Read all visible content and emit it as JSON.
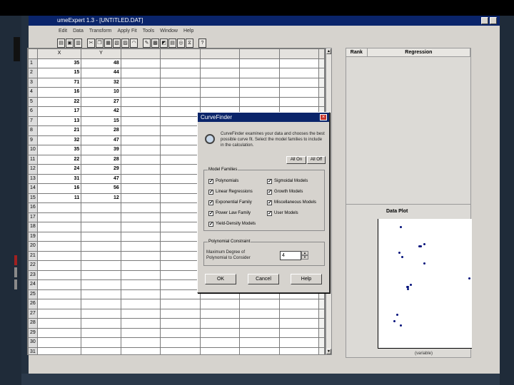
{
  "window": {
    "title": "umeExpert 1.3 - [UNTITLED.DAT]"
  },
  "menu": [
    "Edit",
    "Data",
    "Transform",
    "Apply Fit",
    "Tools",
    "Window",
    "Help"
  ],
  "sheet": {
    "columns": [
      "",
      "X",
      "Y",
      "",
      "",
      "",
      "",
      "",
      ""
    ],
    "rows": [
      {
        "n": "1",
        "x": "35",
        "y": "48"
      },
      {
        "n": "2",
        "x": "15",
        "y": "44"
      },
      {
        "n": "3",
        "x": "71",
        "y": "32"
      },
      {
        "n": "4",
        "x": "16",
        "y": "10"
      },
      {
        "n": "5",
        "x": "22",
        "y": "27"
      },
      {
        "n": "6",
        "x": "17",
        "y": "42"
      },
      {
        "n": "7",
        "x": "13",
        "y": "15"
      },
      {
        "n": "8",
        "x": "21",
        "y": "28"
      },
      {
        "n": "9",
        "x": "32",
        "y": "47"
      },
      {
        "n": "10",
        "x": "35",
        "y": "39"
      },
      {
        "n": "11",
        "x": "22",
        "y": "28"
      },
      {
        "n": "12",
        "x": "24",
        "y": "29"
      },
      {
        "n": "13",
        "x": "31",
        "y": "47"
      },
      {
        "n": "14",
        "x": "16",
        "y": "56"
      },
      {
        "n": "15",
        "x": "11",
        "y": "12"
      },
      {
        "n": "16",
        "x": "",
        "y": ""
      },
      {
        "n": "17",
        "x": "",
        "y": ""
      },
      {
        "n": "18",
        "x": "",
        "y": ""
      },
      {
        "n": "19",
        "x": "",
        "y": ""
      },
      {
        "n": "20",
        "x": "",
        "y": ""
      },
      {
        "n": "21",
        "x": "",
        "y": ""
      },
      {
        "n": "22",
        "x": "",
        "y": ""
      },
      {
        "n": "23",
        "x": "",
        "y": ""
      },
      {
        "n": "24",
        "x": "",
        "y": ""
      },
      {
        "n": "25",
        "x": "",
        "y": ""
      },
      {
        "n": "26",
        "x": "",
        "y": ""
      },
      {
        "n": "27",
        "x": "",
        "y": ""
      },
      {
        "n": "28",
        "x": "",
        "y": ""
      },
      {
        "n": "29",
        "x": "",
        "y": ""
      },
      {
        "n": "30",
        "x": "",
        "y": ""
      },
      {
        "n": "31",
        "x": "",
        "y": ""
      }
    ]
  },
  "rank_panel": {
    "rank_header": "Rank",
    "regression_header": "Regression"
  },
  "plot": {
    "title": "Data Plot",
    "xlabel": "(variable)"
  },
  "dialog": {
    "title": "CurveFinder",
    "description": "CurveFinder examines your data and chooses the best possible curve fit. Select the model families to include in the calculation.",
    "all_on": "All On",
    "all_off": "All Off",
    "model_families_label": "Model Families",
    "families": [
      {
        "label": "Polynomials",
        "checked": true
      },
      {
        "label": "Sigmoidal Models",
        "checked": true
      },
      {
        "label": "Linear Regressions",
        "checked": true
      },
      {
        "label": "Growth Models",
        "checked": true
      },
      {
        "label": "Exponential Family",
        "checked": true
      },
      {
        "label": "Miscellaneous Models",
        "checked": true
      },
      {
        "label": "Power Law Family",
        "checked": true
      },
      {
        "label": "User Models",
        "checked": true
      },
      {
        "label": "Yield-Density Models",
        "checked": true
      }
    ],
    "polynomial_label": "Polynomial Constraint",
    "degree_label": "Maximum Degree of Polynomial to Consider",
    "degree_value": "4",
    "ok": "OK",
    "cancel": "Cancel",
    "help": "Help"
  },
  "icons": {
    "dialog_icon": "magnifier-icon",
    "close": "close-icon",
    "check": "check-icon"
  }
}
